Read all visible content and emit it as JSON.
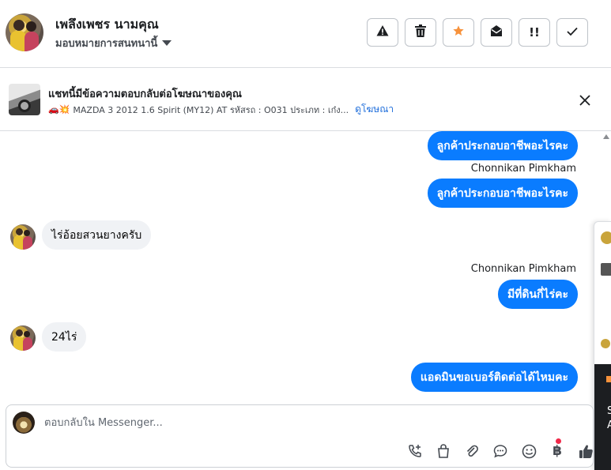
{
  "header": {
    "contact_name": "เพลึงเพชร นามคุณ",
    "assign_label": "มอบหมายการสนทนานี้",
    "tools": [
      {
        "icon": "warning-icon",
        "glyph": "⚠"
      },
      {
        "icon": "trash-icon",
        "glyph": "🗑"
      },
      {
        "icon": "star-icon",
        "glyph": "★"
      },
      {
        "icon": "envelope-open-icon",
        "glyph": "✉"
      },
      {
        "icon": "priority-icon",
        "glyph": "!!"
      },
      {
        "icon": "check-icon",
        "glyph": "✓"
      }
    ],
    "star_color": "#f7923b"
  },
  "ad_banner": {
    "title": "แชทนี้มีข้อความตอบกลับต่อโฆษณาของคุณ",
    "emoji": "🚗💥",
    "description": "MAZDA 3 2012 1.6 Spirit (MY12) AT รหัสรถ : O031 ประเภท : เก๋ง...",
    "link_label": "ดูโฆษณา",
    "close_glyph": "✕"
  },
  "messages": {
    "out_1": "ลูกค้าประกอบอาชีพอะไรคะ",
    "sender_1": "Chonnikan Pimkham",
    "out_2": "ลูกค้าประกอบอาชีพอะไรคะ",
    "in_1": "ไร่อ้อยสวนยางครับ",
    "sender_2": "Chonnikan Pimkham",
    "out_3": "มีที่ดินกี่ไร่คะ",
    "in_2": "24ไร่",
    "out_4": "แอดมินขอเบอร์ติดต่อได้ไหมคะ"
  },
  "side_popup": {
    "letter_1": "S",
    "letter_2": "A"
  },
  "composer": {
    "placeholder": "ตอบกลับใน Messenger...",
    "icons": [
      {
        "icon": "call-add-icon",
        "glyph": "✆"
      },
      {
        "icon": "shopping-bag-icon",
        "glyph": "👜"
      },
      {
        "icon": "paperclip-icon",
        "glyph": "📎"
      },
      {
        "icon": "saved-reply-icon",
        "glyph": "💬"
      },
      {
        "icon": "emoji-icon",
        "glyph": "☺"
      },
      {
        "icon": "baht-payment-icon",
        "glyph": "฿"
      },
      {
        "icon": "thumbs-up-icon",
        "glyph": "👍"
      }
    ]
  },
  "colors": {
    "outgoing_bubble": "#0a7cff",
    "incoming_bubble": "#f0f2f5",
    "link": "#216fdb",
    "notification_dot": "#f02849"
  }
}
